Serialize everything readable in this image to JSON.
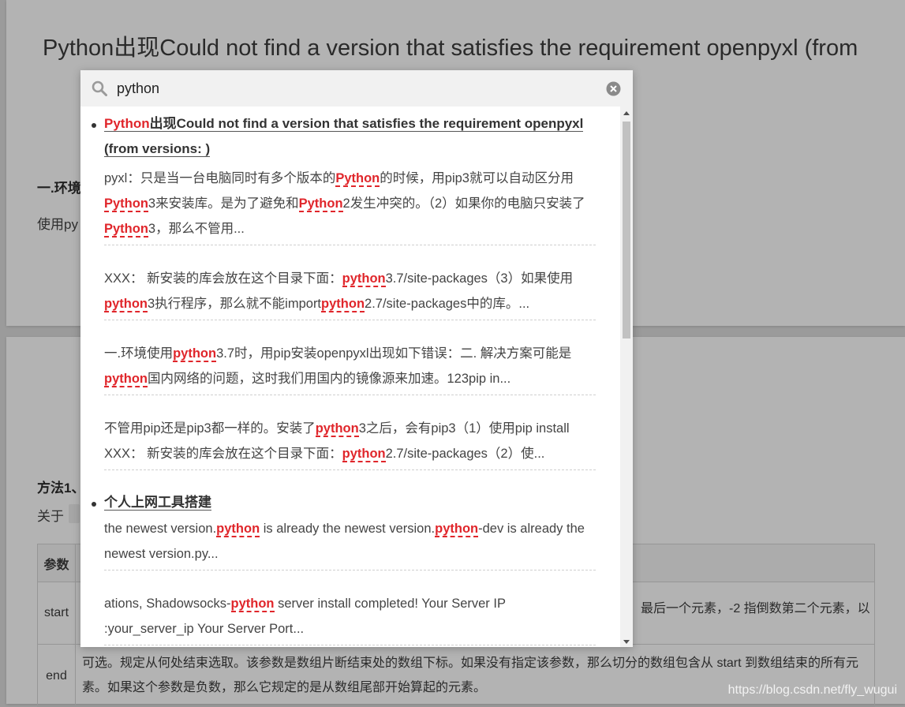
{
  "background": {
    "title": "Python出现Could not find a version that satisfies the requirement openpyxl (from",
    "section_heading": "一.环境",
    "usage_text": "使用py",
    "method_heading": "方法1、",
    "about_text": "关于",
    "table": {
      "header": "参数",
      "row1_label": "start",
      "row1_text": "最后一个元素，-2 指倒数第二个元素，以",
      "row2_label": "end",
      "row2_text_line1": "可选。规定从何处结束选取。该参数是数组片断结束处的数组下标。如果没有指定该参数，那么切分的数组包含从 start 到数组结束的所有元",
      "row2_text_line2": "素。如果这个参数是负数，那么它规定的是从数组尾部开始算起的元素。"
    },
    "watermark": "https://blog.csdn.net/fly_wugui"
  },
  "search": {
    "query": "python",
    "icons": {
      "search": "search-icon",
      "clear": "clear-icon"
    }
  },
  "results": [
    {
      "title": [
        [
          "Python",
          true
        ],
        [
          "出现Could not find a version that satisfies the requirement openpyxl (from versions: )",
          false
        ]
      ],
      "snippets": [
        [
          [
            "pyxl：只是当一台电脑同时有多个版本的",
            false
          ],
          [
            "Python",
            true
          ],
          [
            "的时候，用pip3就可以自动区分用",
            false
          ],
          [
            "Python",
            true
          ],
          [
            "3来安装库。是为了避免和",
            false
          ],
          [
            "Python",
            true
          ],
          [
            "2发生冲突的。（2）如果你的电脑只安装了",
            false
          ],
          [
            "Python",
            true
          ],
          [
            "3，那么不管用...",
            false
          ]
        ],
        [
          [
            "XXX： 新安装的库会放在这个目录下面：",
            false
          ],
          [
            "python",
            true
          ],
          [
            "3.7/site-packages（3）如果使用",
            false
          ],
          [
            "python",
            true
          ],
          [
            "3执行程序，那么就不能import",
            false
          ],
          [
            "python",
            true
          ],
          [
            "2.7/site-packages中的库。...",
            false
          ]
        ],
        [
          [
            "一.环境使用",
            false
          ],
          [
            "python",
            true
          ],
          [
            "3.7时，用pip安装openpyxl出现如下错误：二. 解决方案可能是",
            false
          ],
          [
            "python",
            true
          ],
          [
            "国内网络的问题，这时我们用国内的镜像源来加速。123pip in...",
            false
          ]
        ],
        [
          [
            "不管用pip还是pip3都一样的。安装了",
            false
          ],
          [
            "python",
            true
          ],
          [
            "3之后，会有pip3（1）使用pip install XXX： 新安装的库会放在这个目录下面：",
            false
          ],
          [
            "python",
            true
          ],
          [
            "2.7/site-packages（2）使...",
            false
          ]
        ]
      ]
    },
    {
      "title": [
        [
          "个人上网工具搭建",
          false
        ]
      ],
      "snippets": [
        [
          [
            "the newest version.",
            false
          ],
          [
            "python",
            true
          ],
          [
            " is already the newest version.",
            false
          ],
          [
            "python",
            true
          ],
          [
            "-dev is already the newest version.py...",
            false
          ]
        ],
        [
          [
            "ations, Shadowsocks-",
            false
          ],
          [
            "python",
            true
          ],
          [
            " server install completed! Your Server IP :your_server_ip Your Server Port...",
            false
          ]
        ]
      ]
    }
  ]
}
